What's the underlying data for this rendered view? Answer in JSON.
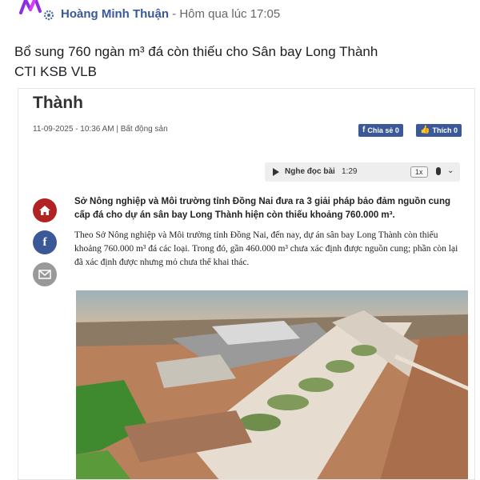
{
  "post": {
    "author": "Hoàng Minh Thuận",
    "separator": " - ",
    "time": "Hôm qua lúc 17:05",
    "text_line1": "Bổ sung 760 ngàn m³ đá còn thiếu cho Sân bay Long Thành",
    "text_line2": "CTI KSB VLB"
  },
  "article": {
    "headline_tail": "Thành",
    "meta": "11-09-2025 - 10:36 AM | Bất động sản",
    "share_label": "Chia sẻ 0",
    "like_label": "Thích 0",
    "audio": {
      "label": "Nghe đọc bài",
      "duration": "1:29",
      "speed": "1x"
    },
    "sapo": "Sở Nông nghiệp và Môi trường tỉnh Đồng Nai đưa ra 3 giải pháp bảo đảm nguồn cung cấp đá cho dự án sân bay Long Thành hiện còn thiếu khoảng 760.000 m³.",
    "body": "Theo Sở Nông nghiệp và Môi trường tỉnh Đồng Nai, đến nay, dự án sân bay Long Thành còn thiếu khoảng 760.000 m³ đá các loại. Trong đó, gần 460.000 m³ chưa xác định được nguồn cung; phần còn lại đã xác định được nhưng mỏ chưa thể khai thác.",
    "icons": [
      "home-icon",
      "facebook-icon",
      "mail-icon",
      "play-icon",
      "microphone-icon",
      "chevron-down-icon"
    ]
  }
}
